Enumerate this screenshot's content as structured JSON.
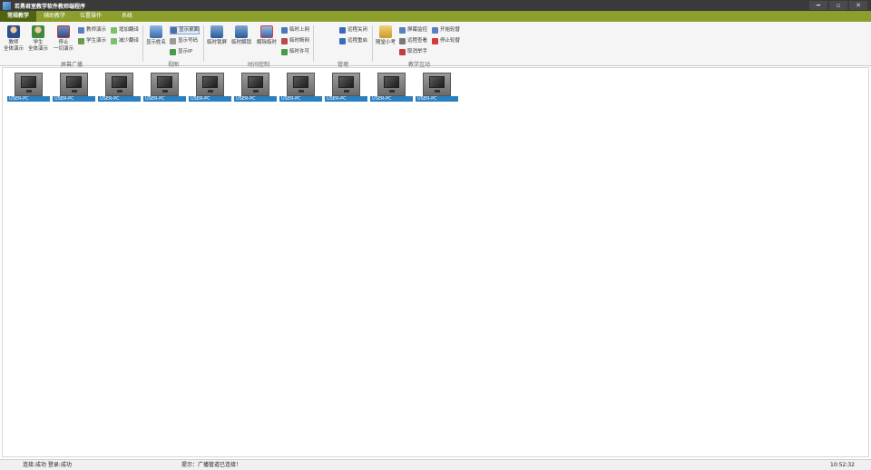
{
  "window": {
    "title": "若勇君室教学软件教师端程序",
    "controls": {
      "minimize": "━",
      "restore": "▫",
      "close": "✕"
    }
  },
  "tabs": [
    "常规教学",
    "辅助教学",
    "位置操作",
    "系统"
  ],
  "ribbon": {
    "groups": {
      "screen_broadcast": {
        "label": "屏幕广播",
        "big": [
          {
            "label": "教师\n全体演示",
            "icon": "teacher-demo-icon"
          },
          {
            "label": "学生\n全体演示",
            "icon": "student-demo-icon"
          },
          {
            "label": "停止\n一切演示",
            "icon": "stop-demo-icon"
          }
        ],
        "small": [
          {
            "label": "教师演示",
            "icon": "teacher-small-icon"
          },
          {
            "label": "学生演示",
            "icon": "student-small-icon"
          },
          {
            "label": "增加翻译",
            "icon": "add-icon"
          },
          {
            "label": "减少翻译",
            "icon": "reduce-icon"
          }
        ]
      },
      "view": {
        "label": "视图",
        "big": [
          {
            "label": "显示姓名",
            "icon": "show-name-icon"
          }
        ],
        "small": [
          {
            "label": "显示桌面",
            "icon": "desktop-icon"
          },
          {
            "label": "显示号码",
            "icon": "number-icon"
          },
          {
            "label": "显示IP",
            "icon": "ip-icon"
          }
        ]
      },
      "timed_control": {
        "label": "时间控制",
        "big": [
          {
            "label": "临时锁屏",
            "icon": "lock-screen-icon"
          },
          {
            "label": "临时解锁",
            "icon": "unlock-icon"
          },
          {
            "label": "解除临时",
            "icon": "release-icon"
          }
        ],
        "small": [
          {
            "label": "临时上网",
            "icon": "internet-icon"
          },
          {
            "label": "临时断网",
            "icon": "disconnect-icon"
          },
          {
            "label": "临时许可",
            "icon": "permit-icon"
          }
        ]
      },
      "manage": {
        "label": "管理",
        "small": [
          {
            "label": "远程关闭",
            "icon": "remote-shutdown-icon"
          },
          {
            "label": "远程重启",
            "icon": "remote-restart-icon"
          }
        ]
      },
      "interaction": {
        "label": "教学互动",
        "big": [
          {
            "label": "随堂小考",
            "icon": "quiz-icon"
          }
        ],
        "small": [
          {
            "label": "屏幕监控",
            "icon": "monitor-icon"
          },
          {
            "label": "远程查看",
            "icon": "remote-view-icon"
          },
          {
            "label": "取消举手",
            "icon": "cancel-hand-icon"
          },
          {
            "label": "开始轮替",
            "icon": "start-rotate-icon"
          },
          {
            "label": "停止轮替",
            "icon": "stop-rotate-icon"
          }
        ]
      }
    }
  },
  "students": [
    {
      "label": "USER-PC"
    },
    {
      "label": "USER-PC"
    },
    {
      "label": "USER-PC"
    },
    {
      "label": "USER-PC"
    },
    {
      "label": "USER-PC"
    },
    {
      "label": "USER-PC"
    },
    {
      "label": "USER-PC"
    },
    {
      "label": "USER-PC"
    },
    {
      "label": "USER-PC"
    },
    {
      "label": "USER-PC"
    }
  ],
  "status": {
    "left": "连接:成功   登录:成功",
    "message": "提示：广播管道已连接！",
    "time": "10:52:32"
  },
  "colors": {
    "tab_bar": "#8c9e2b",
    "tab_active": "#4f6410",
    "tile_label": "#2a7fc1",
    "title_bar": "#3a3a3a"
  }
}
